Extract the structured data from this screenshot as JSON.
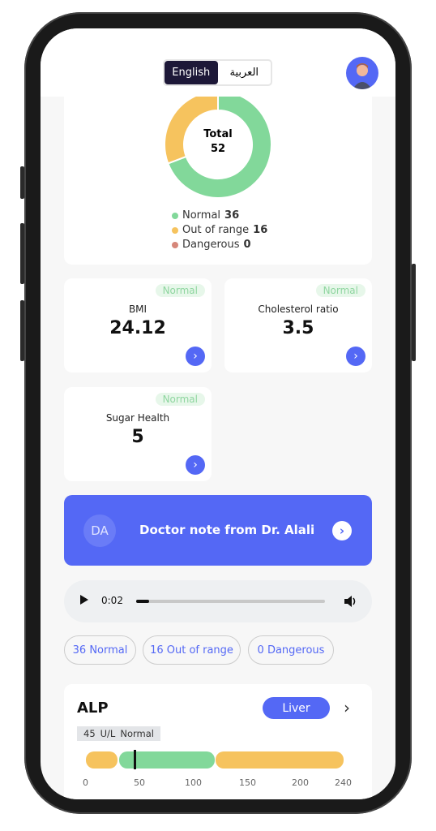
{
  "header": {
    "lang_english": "English",
    "lang_arabic": "العربية",
    "avatar": "user-avatar"
  },
  "summary": {
    "total_label": "Total",
    "total": "52",
    "legend": [
      {
        "label": "Normal",
        "value": "36",
        "color": "#82d89a"
      },
      {
        "label": "Out of range",
        "value": "16",
        "color": "#f6c35e"
      },
      {
        "label": "Dangerous",
        "value": "0",
        "color": "#d6877a"
      }
    ]
  },
  "chart_data": {
    "type": "pie",
    "categories": [
      "Normal",
      "Out of range",
      "Dangerous"
    ],
    "values": [
      36,
      16,
      0
    ],
    "colors": [
      "#82d89a",
      "#f6c35e",
      "#d6877a"
    ],
    "title": "Total 52"
  },
  "metrics": [
    {
      "label": "BMI",
      "value": "24.12",
      "status": "Normal"
    },
    {
      "label": "Cholesterol ratio",
      "value": "3.5",
      "status": "Normal"
    },
    {
      "label": "Sugar Health",
      "value": "5",
      "status": "Normal"
    }
  ],
  "doctor": {
    "initials": "DA",
    "text": "Doctor note from Dr. Alali"
  },
  "audio": {
    "time": "0:02",
    "progress": 0.07
  },
  "filters": [
    {
      "count": "36",
      "label": "Normal"
    },
    {
      "count": "16",
      "label": "Out of range"
    },
    {
      "count": "0",
      "label": "Dangerous"
    }
  ],
  "test": {
    "name": "ALP",
    "category": "Liver",
    "value": "45",
    "unit": "U/L",
    "status": "Normal",
    "marker": 45,
    "ticks": [
      "0",
      "50",
      "100",
      "150",
      "200",
      "240"
    ]
  }
}
